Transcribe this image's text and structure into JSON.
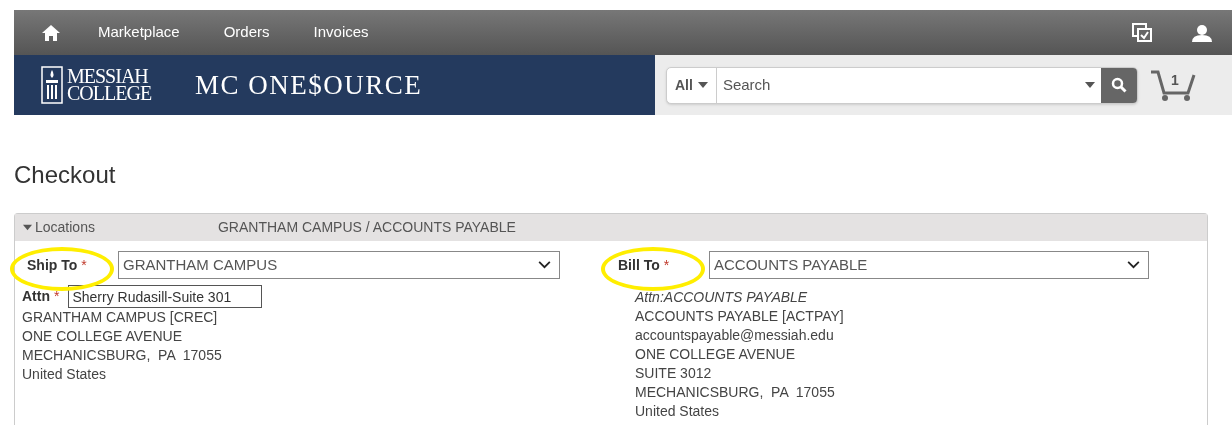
{
  "nav": {
    "items": [
      {
        "label": "Marketplace"
      },
      {
        "label": "Orders"
      },
      {
        "label": "Invoices"
      }
    ]
  },
  "banner": {
    "logo_lines": [
      "MESSIAH",
      "COLLEGE"
    ],
    "site_name": "MC ONE$OURCE",
    "search": {
      "scope": "All",
      "placeholder": "Search"
    },
    "cart_count": "1"
  },
  "page": {
    "title": "Checkout"
  },
  "locations": {
    "header": "Locations",
    "expanded": true,
    "summary": "GRANTHAM CAMPUS / ACCOUNTS PAYABLE",
    "ship_to": {
      "label": "Ship To",
      "required": "*",
      "value": "GRANTHAM CAMPUS",
      "highlighted": true,
      "attn_label": "Attn",
      "attn_value": "Sherry Rudasill-Suite 301",
      "address": [
        "GRANTHAM CAMPUS [CREC]",
        "ONE COLLEGE AVENUE",
        "MECHANICSBURG,  PA  17055",
        "United States"
      ]
    },
    "bill_to": {
      "label": "Bill To",
      "required": "*",
      "value": "ACCOUNTS PAYABLE",
      "highlighted": true,
      "attn_line": "Attn:ACCOUNTS PAYABLE",
      "address": [
        "ACCOUNTS PAYABLE [ACTPAY]",
        "accountspayable@messiah.edu",
        "ONE COLLEGE AVENUE",
        "SUITE 3012",
        "MECHANICSBURG,  PA  17055",
        "United States"
      ]
    }
  }
}
